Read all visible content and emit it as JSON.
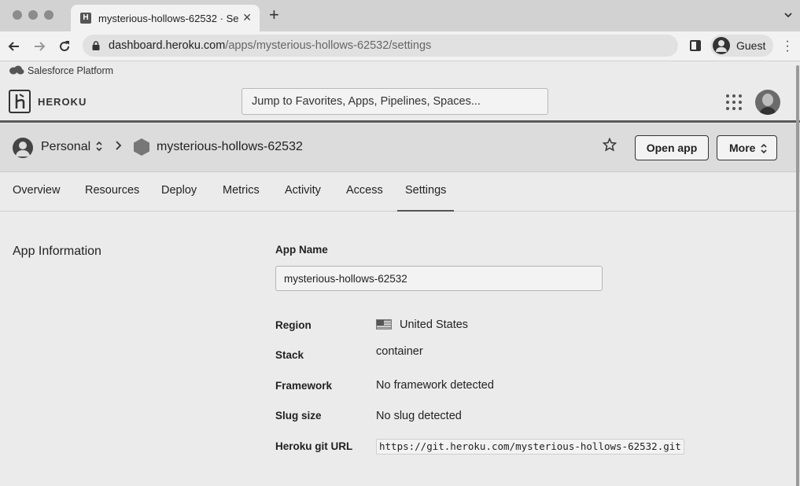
{
  "browser": {
    "tab_title": "mysterious-hollows-62532 · Se",
    "tab_close": "✕",
    "new_tab": "+",
    "url_host": "dashboard.heroku.com",
    "url_path": "/apps/mysterious-hollows-62532/settings",
    "profile_label": "Guest"
  },
  "bookmarks": {
    "salesforce_label": "Salesforce Platform"
  },
  "heroku": {
    "brand": "HEROKU",
    "search_placeholder": "Jump to Favorites, Apps, Pipelines, Spaces..."
  },
  "app_header": {
    "account": "Personal",
    "app_name": "mysterious-hollows-62532",
    "open_app_label": "Open app",
    "more_label": "More"
  },
  "tabs": [
    {
      "label": "Overview"
    },
    {
      "label": "Resources"
    },
    {
      "label": "Deploy"
    },
    {
      "label": "Metrics"
    },
    {
      "label": "Activity"
    },
    {
      "label": "Access"
    },
    {
      "label": "Settings",
      "active": true
    }
  ],
  "settings": {
    "section_title": "App Information",
    "app_name_label": "App Name",
    "app_name_value": "mysterious-hollows-62532",
    "region_label": "Region",
    "region_value": "United States",
    "stack_label": "Stack",
    "stack_value": "container",
    "framework_label": "Framework",
    "framework_value": "No framework detected",
    "slug_label": "Slug size",
    "slug_value": "No slug detected",
    "git_url_label": "Heroku git URL",
    "git_url_value": "https://git.heroku.com/mysterious-hollows-62532.git"
  },
  "colors": {
    "page_bg": "#ebebeb",
    "header_bg": "#dcdcdc",
    "text": "#222222"
  }
}
